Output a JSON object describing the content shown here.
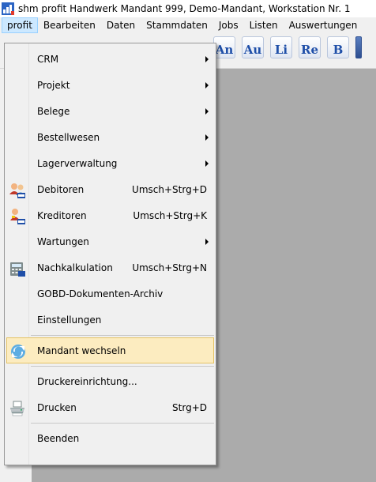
{
  "window": {
    "title": "shm profit Handwerk   Mandant 999, Demo-Mandant, Workstation Nr. 1"
  },
  "menubar": {
    "items": [
      {
        "label": "profit"
      },
      {
        "label": "Bearbeiten"
      },
      {
        "label": "Daten"
      },
      {
        "label": "Stammdaten"
      },
      {
        "label": "Jobs"
      },
      {
        "label": "Listen"
      },
      {
        "label": "Auswertungen"
      }
    ]
  },
  "toolbar": {
    "buttons": [
      {
        "label": "An",
        "icon": "angebot-icon"
      },
      {
        "label": "Au",
        "icon": "auftrag-icon"
      },
      {
        "label": "Li",
        "icon": "lieferschein-icon"
      },
      {
        "label": "Re",
        "icon": "rechnung-icon"
      },
      {
        "label": "B",
        "icon": "bestellung-icon"
      }
    ]
  },
  "profit_menu": {
    "items": [
      {
        "label": "CRM",
        "submenu": true
      },
      {
        "label": "Projekt",
        "submenu": true
      },
      {
        "label": "Belege",
        "submenu": true
      },
      {
        "label": "Bestellwesen",
        "submenu": true
      },
      {
        "label": "Lagerverwaltung",
        "submenu": true
      },
      {
        "label": "Debitoren",
        "shortcut": "Umsch+Strg+D",
        "icon": "debitoren-icon"
      },
      {
        "label": "Kreditoren",
        "shortcut": "Umsch+Strg+K",
        "icon": "kreditoren-icon"
      },
      {
        "label": "Wartungen",
        "submenu": true
      },
      {
        "label": "Nachkalkulation",
        "shortcut": "Umsch+Strg+N",
        "icon": "calculator-icon"
      },
      {
        "label": "GOBD-Dokumenten-Archiv"
      },
      {
        "label": "Einstellungen"
      },
      {
        "label": "Mandant wechseln",
        "icon": "switch-mandant-icon",
        "highlighted": true
      },
      {
        "label": "Druckereinrichtung..."
      },
      {
        "label": "Drucken",
        "shortcut": "Strg+D",
        "icon": "printer-icon"
      },
      {
        "label": "Beenden"
      }
    ]
  },
  "colors": {
    "menu_highlight_bg": "#fcecc0",
    "menu_highlight_border": "#e5c365",
    "menubar_active_bg": "#cce8ff",
    "workspace_bg": "#ababab",
    "menu_bg": "#f0f0f0"
  }
}
